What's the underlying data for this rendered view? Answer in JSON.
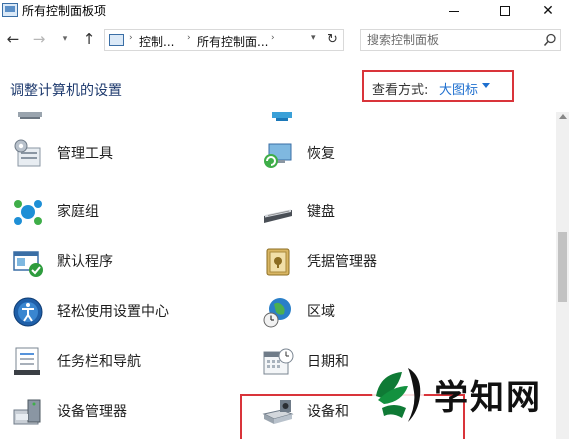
{
  "window": {
    "title": "所有控制面板项"
  },
  "nav": {
    "back_icon": "arrow-left-icon",
    "forward_icon": "arrow-right-icon",
    "recent_icon": "chevron-down-icon",
    "up_icon": "arrow-up-icon",
    "breadcrumb": [
      "控制...",
      "所有控制面..."
    ],
    "refresh_icon": "refresh-icon"
  },
  "search": {
    "placeholder": "搜索控制面板"
  },
  "header": {
    "title": "调整计算机的设置",
    "view_label": "查看方式:",
    "view_value": "大图标"
  },
  "items": [
    {
      "label": "管理工具",
      "icon": "admin-tools-icon"
    },
    {
      "label": "恢复",
      "icon": "recovery-icon"
    },
    {
      "label": "家庭组",
      "icon": "homegroup-icon"
    },
    {
      "label": "键盘",
      "icon": "keyboard-icon"
    },
    {
      "label": "默认程序",
      "icon": "default-programs-icon"
    },
    {
      "label": "凭据管理器",
      "icon": "credential-manager-icon"
    },
    {
      "label": "轻松使用设置中心",
      "icon": "ease-of-access-icon"
    },
    {
      "label": "区域",
      "icon": "region-icon"
    },
    {
      "label": "任务栏和导航",
      "icon": "taskbar-icon"
    },
    {
      "label": "日期和",
      "icon": "date-time-icon"
    },
    {
      "label": "设备管理器",
      "icon": "device-manager-icon"
    },
    {
      "label": "设备和",
      "icon": "devices-printers-icon"
    }
  ],
  "colors": {
    "highlight": "#d9343a",
    "link_blue": "#1e6fcf",
    "title_blue": "#1e3a6e"
  },
  "watermark": {
    "text": "学知网"
  }
}
